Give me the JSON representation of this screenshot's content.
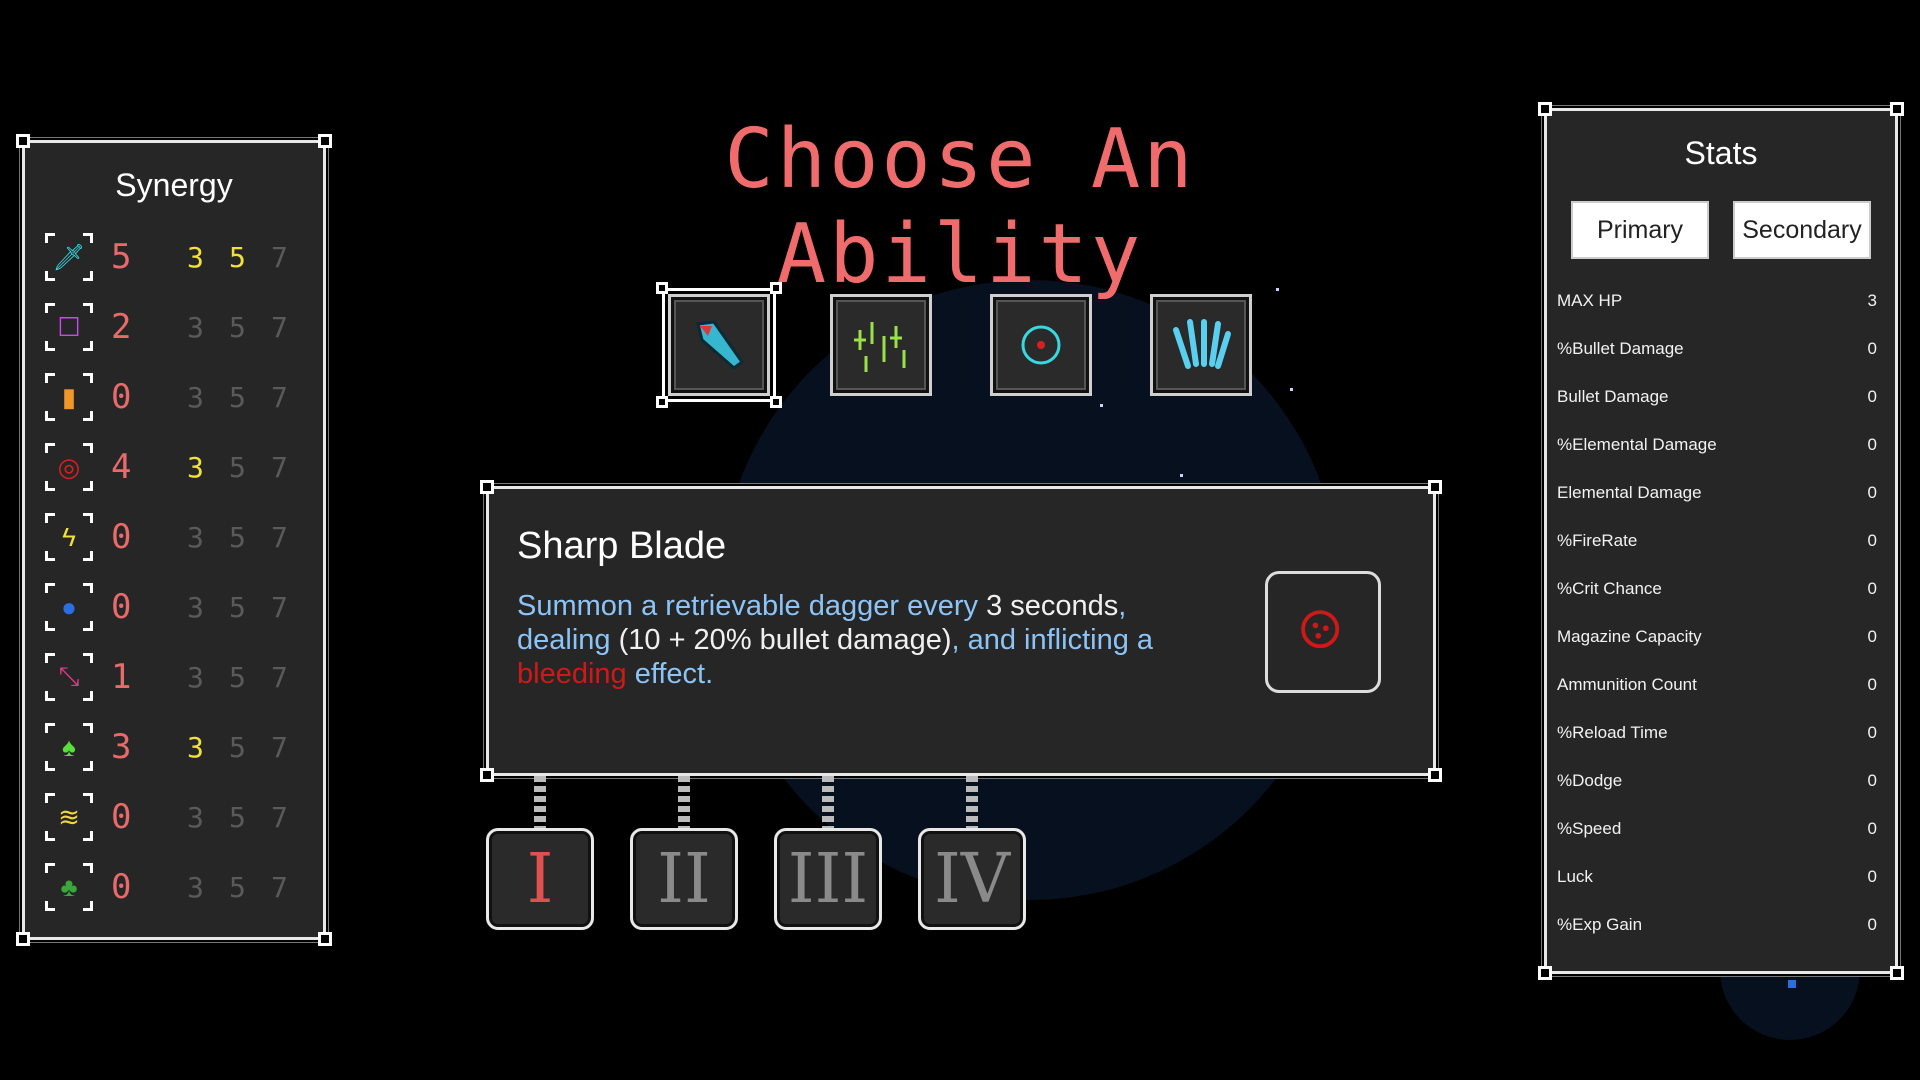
{
  "title": "Choose An Ability",
  "synergy": {
    "title": "Synergy",
    "rows": [
      {
        "icon": "sword-icon",
        "glyph": "🗡",
        "color": "#37d8e0",
        "count": "5",
        "t1": "3",
        "t2": "5",
        "t3": "7",
        "lit": 2
      },
      {
        "icon": "ghost-icon",
        "glyph": "☐",
        "color": "#c84ae8",
        "count": "2",
        "t1": "3",
        "t2": "5",
        "t3": "7",
        "lit": 0
      },
      {
        "icon": "bullet-icon",
        "glyph": "▮",
        "color": "#f0962a",
        "count": "0",
        "t1": "3",
        "t2": "5",
        "t3": "7",
        "lit": 0
      },
      {
        "icon": "bleed-icon",
        "glyph": "◎",
        "color": "#d82020",
        "count": "4",
        "t1": "3",
        "t2": "5",
        "t3": "7",
        "lit": 1
      },
      {
        "icon": "lightning-icon",
        "glyph": "ϟ",
        "color": "#f2e13a",
        "count": "0",
        "t1": "3",
        "t2": "5",
        "t3": "7",
        "lit": 0
      },
      {
        "icon": "water-drop-icon",
        "glyph": "●",
        "color": "#2a6ee0",
        "count": "0",
        "t1": "3",
        "t2": "5",
        "t3": "7",
        "lit": 0
      },
      {
        "icon": "arrows-icon",
        "glyph": "⤡",
        "color": "#e03a8a",
        "count": "1",
        "t1": "3",
        "t2": "5",
        "t3": "7",
        "lit": 0
      },
      {
        "icon": "leaf-icon",
        "glyph": "♠",
        "color": "#58e03a",
        "count": "3",
        "t1": "3",
        "t2": "5",
        "t3": "7",
        "lit": 1
      },
      {
        "icon": "coins-icon",
        "glyph": "≋",
        "color": "#f2d83a",
        "count": "0",
        "t1": "3",
        "t2": "5",
        "t3": "7",
        "lit": 0
      },
      {
        "icon": "tree-icon",
        "glyph": "♣",
        "color": "#3aa83a",
        "count": "0",
        "t1": "3",
        "t2": "5",
        "t3": "7",
        "lit": 0
      }
    ]
  },
  "abilities": [
    {
      "name": "dagger-ability-icon",
      "selected": true
    },
    {
      "name": "sparks-ability-icon",
      "selected": false
    },
    {
      "name": "target-ability-icon",
      "selected": false
    },
    {
      "name": "claws-ability-icon",
      "selected": false
    }
  ],
  "description": {
    "title": "Sharp Blade",
    "seg1": "Summon a retrievable dagger every ",
    "seg2": "3 seconds",
    "seg3": ",",
    "seg4": "dealing ",
    "seg5": "(10 + 20% bullet damage)",
    "seg6": ", and inflicting a",
    "seg7": "bleeding",
    "seg8": " effect.",
    "icon": "bleed-icon"
  },
  "tiers": [
    "I",
    "II",
    "III",
    "IV"
  ],
  "stats": {
    "title": "Stats",
    "tab_primary": "Primary",
    "tab_secondary": "Secondary",
    "rows": [
      {
        "name": "MAX HP",
        "value": "3"
      },
      {
        "name": "%Bullet Damage",
        "value": "0"
      },
      {
        "name": "Bullet Damage",
        "value": "0"
      },
      {
        "name": "%Elemental Damage",
        "value": "0"
      },
      {
        "name": "Elemental Damage",
        "value": "0"
      },
      {
        "name": "%FireRate",
        "value": "0"
      },
      {
        "name": "%Crit Chance",
        "value": "0"
      },
      {
        "name": "Magazine Capacity",
        "value": "0"
      },
      {
        "name": "Ammunition Count",
        "value": "0"
      },
      {
        "name": "%Reload Time",
        "value": "0"
      },
      {
        "name": "%Dodge",
        "value": "0"
      },
      {
        "name": "%Speed",
        "value": "0"
      },
      {
        "name": "Luck",
        "value": "0"
      },
      {
        "name": "%Exp Gain",
        "value": "0"
      }
    ]
  },
  "colors": {
    "title": "#f06c6c",
    "accent_blue": "#8cc4f7",
    "bleed_red": "#d11818",
    "synergy_active": "#f2e13a"
  }
}
